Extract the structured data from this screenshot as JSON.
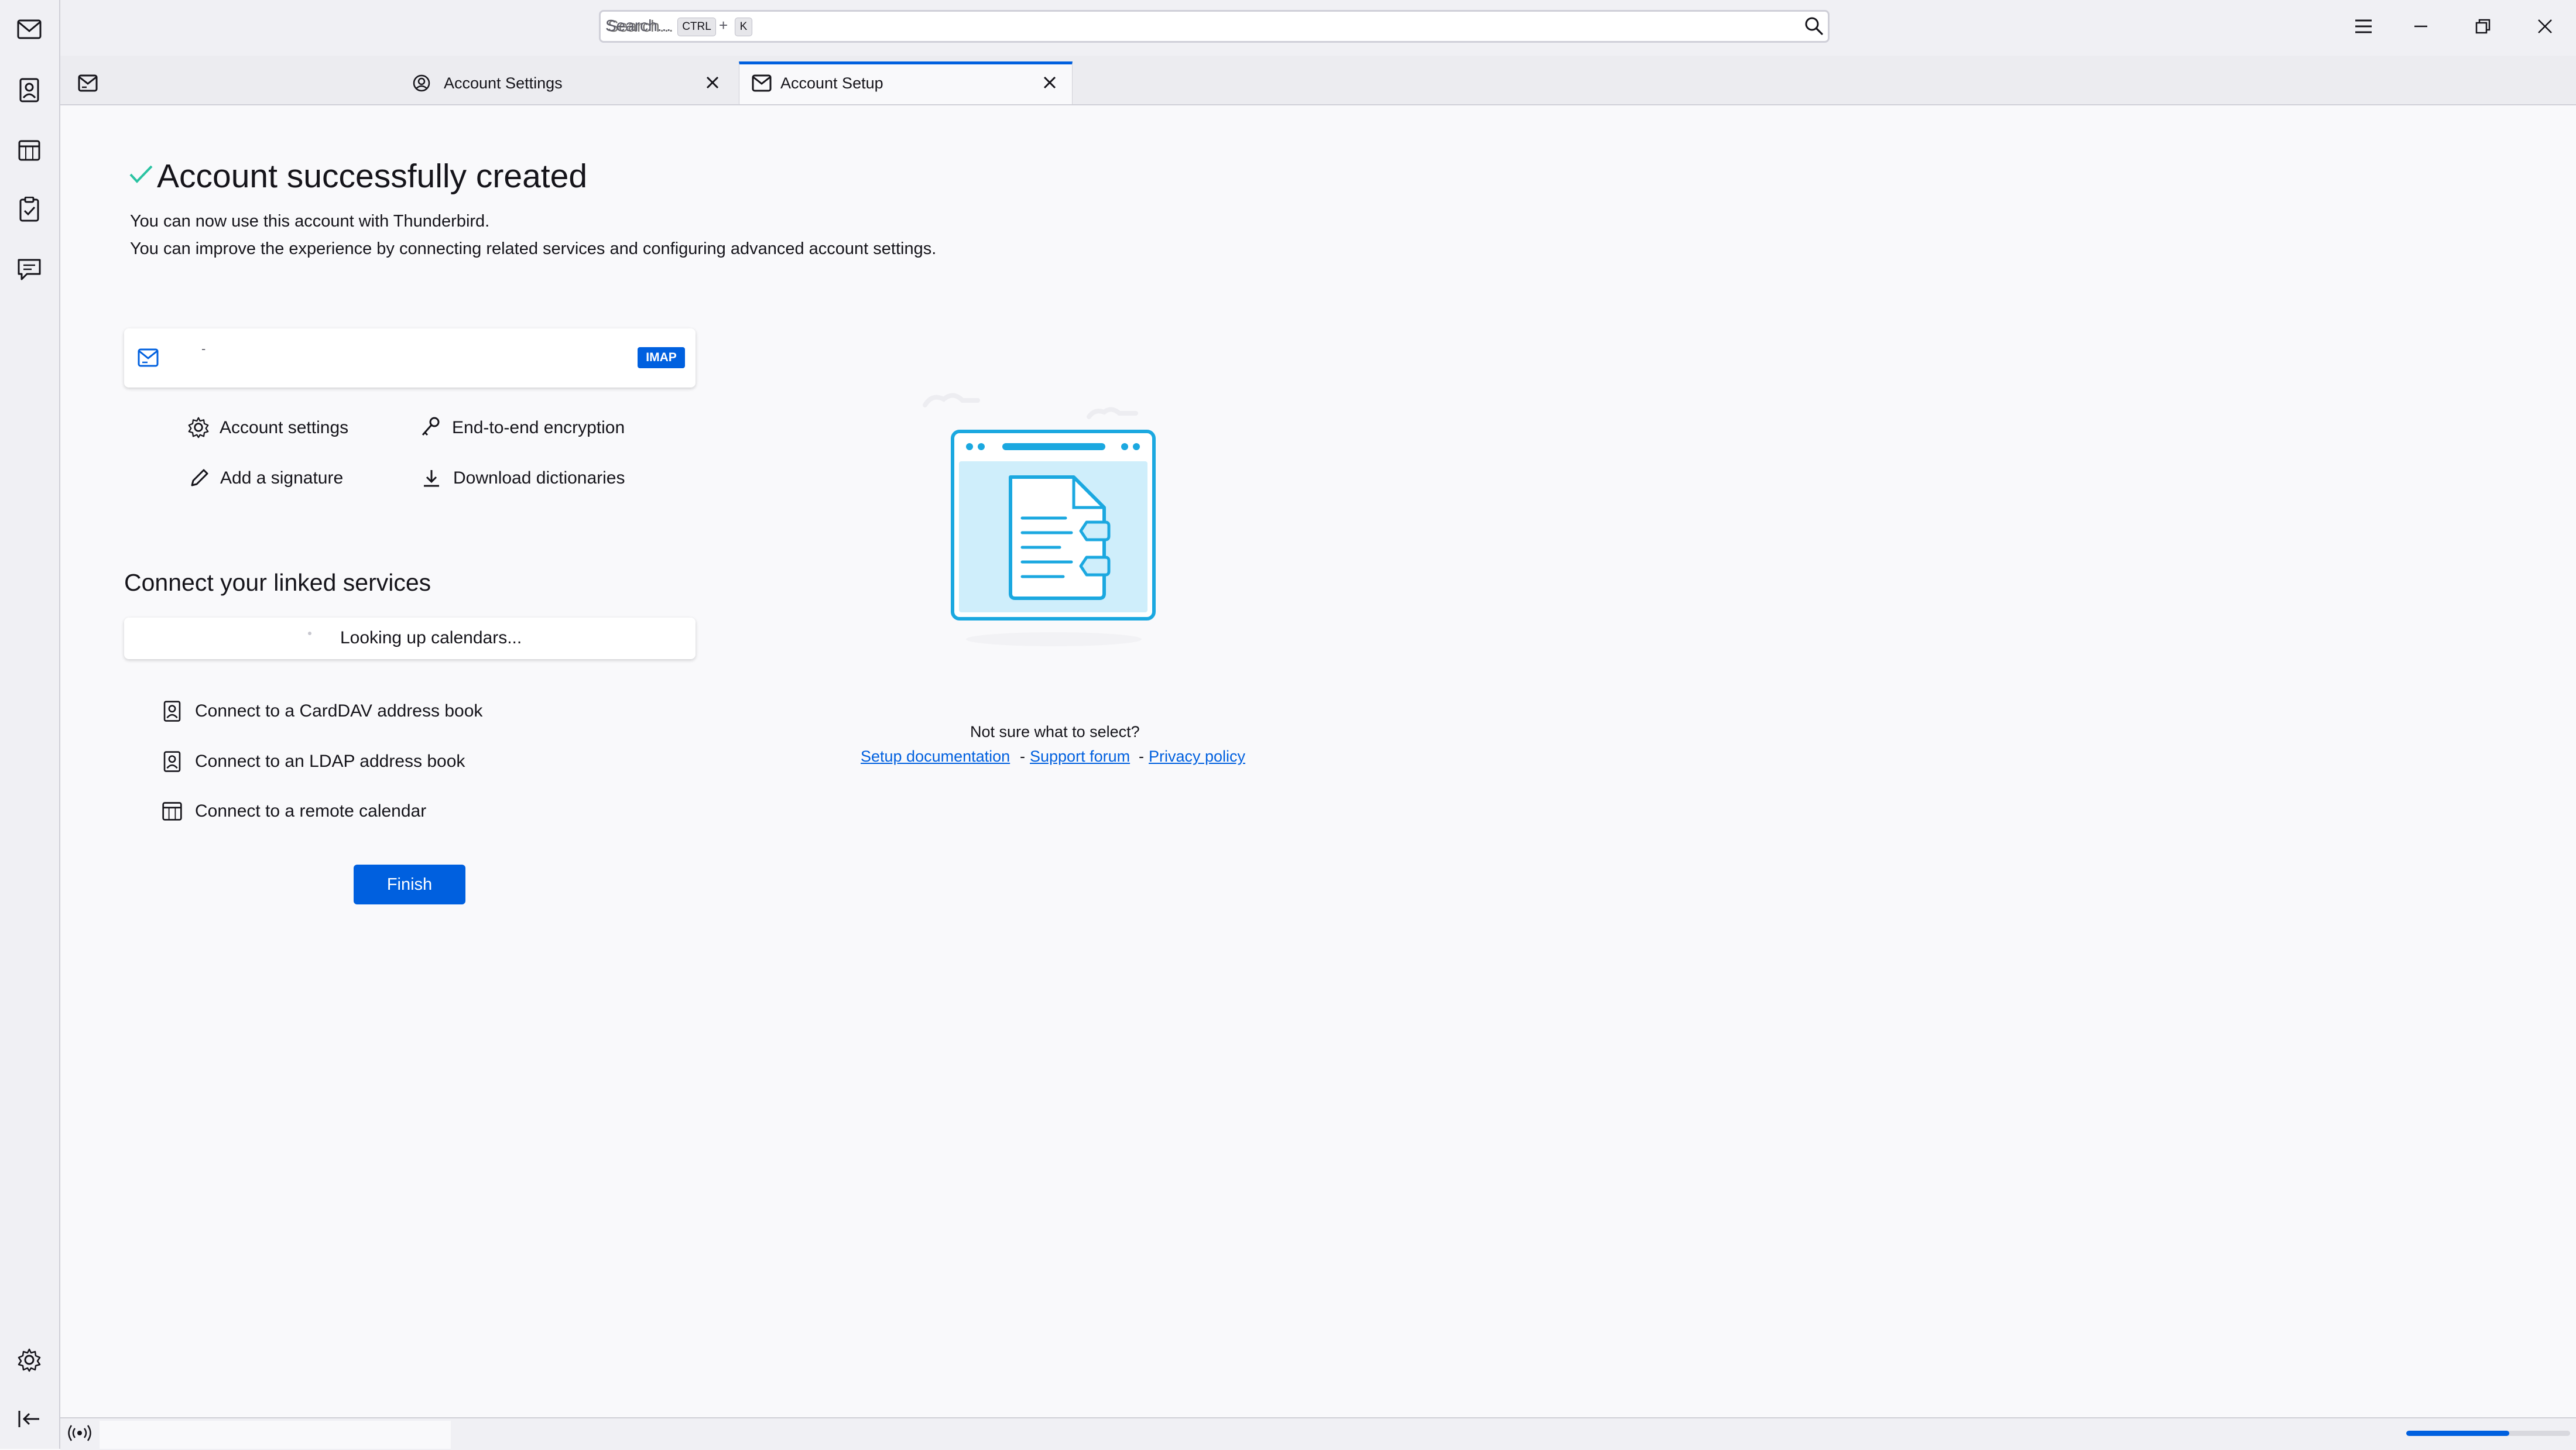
{
  "search": {
    "placeholder": "Search...",
    "shortcut_key1": "CTRL",
    "shortcut_plus": "+",
    "shortcut_key2": "K"
  },
  "window_controls": {
    "menu_icon": "hamburger-icon",
    "minimize_icon": "minimize-icon",
    "restore_icon": "restore-icon",
    "close_icon": "close-icon"
  },
  "spaces": {
    "items": [
      "mail-icon",
      "address-book-icon",
      "calendar-icon",
      "tasks-icon",
      "chat-icon"
    ],
    "settings_icon": "gear-icon",
    "collapse_icon": "collapse-left-icon"
  },
  "tabs": [
    {
      "label": "Account Settings",
      "icon": "account-settings-icon",
      "active": false
    },
    {
      "label": "Account Setup",
      "icon": "account-setup-icon",
      "active": true
    }
  ],
  "success": {
    "title": "Account successfully created",
    "line1": "You can now use this account with Thunderbird.",
    "line2": "You can improve the experience by connecting related services and configuring advanced account settings."
  },
  "account_card": {
    "name": "-",
    "protocol": "IMAP"
  },
  "actions": {
    "account_settings": "Account settings",
    "e2e": "End-to-end encryption",
    "signature": "Add a signature",
    "dictionaries": "Download dictionaries"
  },
  "linked": {
    "title": "Connect your linked services",
    "lookup": "Looking up calendars...",
    "carddav": "Connect to a CardDAV address book",
    "ldap": "Connect to an LDAP address book",
    "calendar": "Connect to a remote calendar"
  },
  "finish_label": "Finish",
  "help": {
    "question": "Not sure what to select?",
    "setup_doc": "Setup documentation",
    "support": "Support forum",
    "privacy": "Privacy policy",
    "separator": "-"
  },
  "status": {
    "progress_fraction": 0.63
  },
  "colors": {
    "accent": "#0060df",
    "success_check": "#2ac3a2",
    "illustration": "#1ba8e0"
  }
}
